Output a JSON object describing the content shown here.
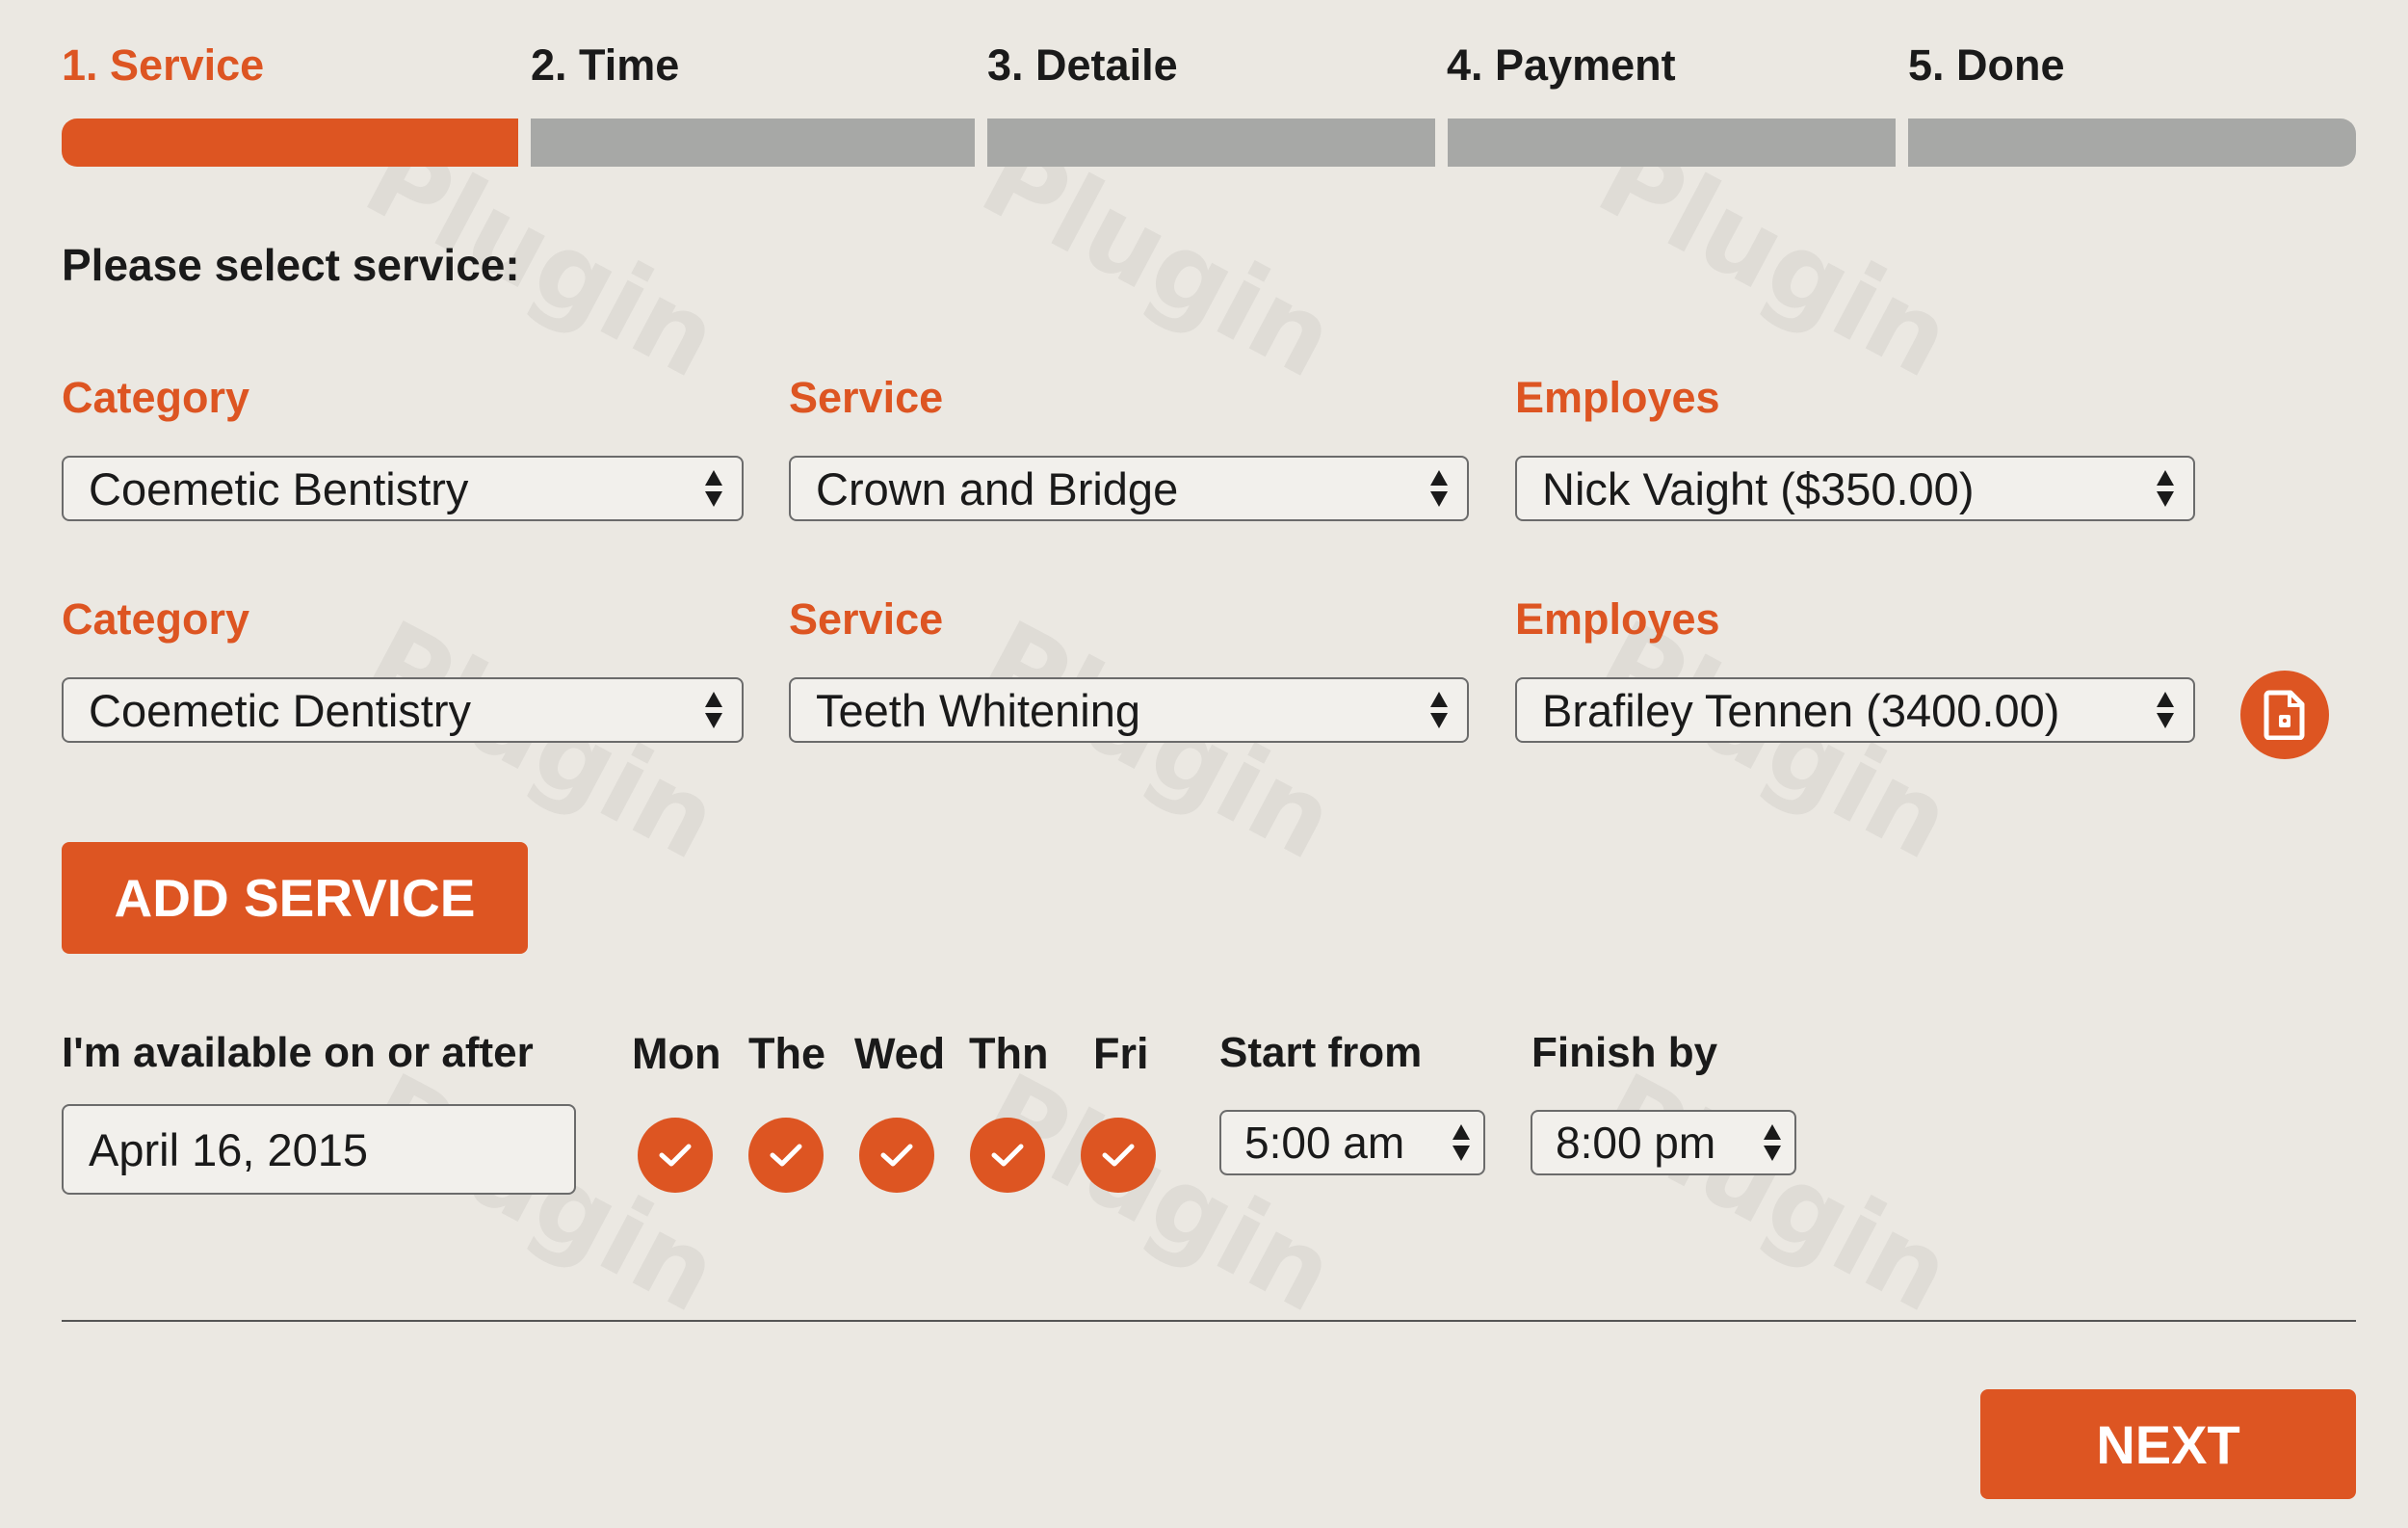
{
  "colors": {
    "accent": "#dd5522",
    "inactive_step": "#a7a8a6",
    "background": "#ebe8e2"
  },
  "watermark_text": "Plugin",
  "steps": [
    {
      "label": "1. Service",
      "active": true
    },
    {
      "label": "2. Time",
      "active": false
    },
    {
      "label": "3. Detaile",
      "active": false
    },
    {
      "label": "4. Payment",
      "active": false
    },
    {
      "label": "5. Done",
      "active": false
    }
  ],
  "section_title": "Please select service:",
  "service_rows": [
    {
      "category_label": "Category",
      "category_value": "Coemetic Bentistry",
      "service_label": "Service",
      "service_value": "Crown and Bridge",
      "employee_label": "Employes",
      "employee_value": "Nick Vaight ($350.00)"
    },
    {
      "category_label": "Category",
      "category_value": "Coemetic Dentistry",
      "service_label": "Service",
      "service_value": "Teeth Whitening",
      "employee_label": "Employes",
      "employee_value": "Brafiley Tennen (3400.00)",
      "remove_icon": "document-remove-icon"
    }
  ],
  "add_service_label": "ADD SERVICE",
  "availability": {
    "label": "I'm available on or after",
    "date_value": "April 16, 2015",
    "days": [
      {
        "label": "Mon",
        "checked": true
      },
      {
        "label": "The",
        "checked": true
      },
      {
        "label": "Wed",
        "checked": true
      },
      {
        "label": "Thn",
        "checked": true
      },
      {
        "label": "Fri",
        "checked": true
      }
    ],
    "start_label": "Start from",
    "start_value": "5:00 am",
    "finish_label": "Finish by",
    "finish_value": "8:00 pm"
  },
  "next_label": "NEXT"
}
